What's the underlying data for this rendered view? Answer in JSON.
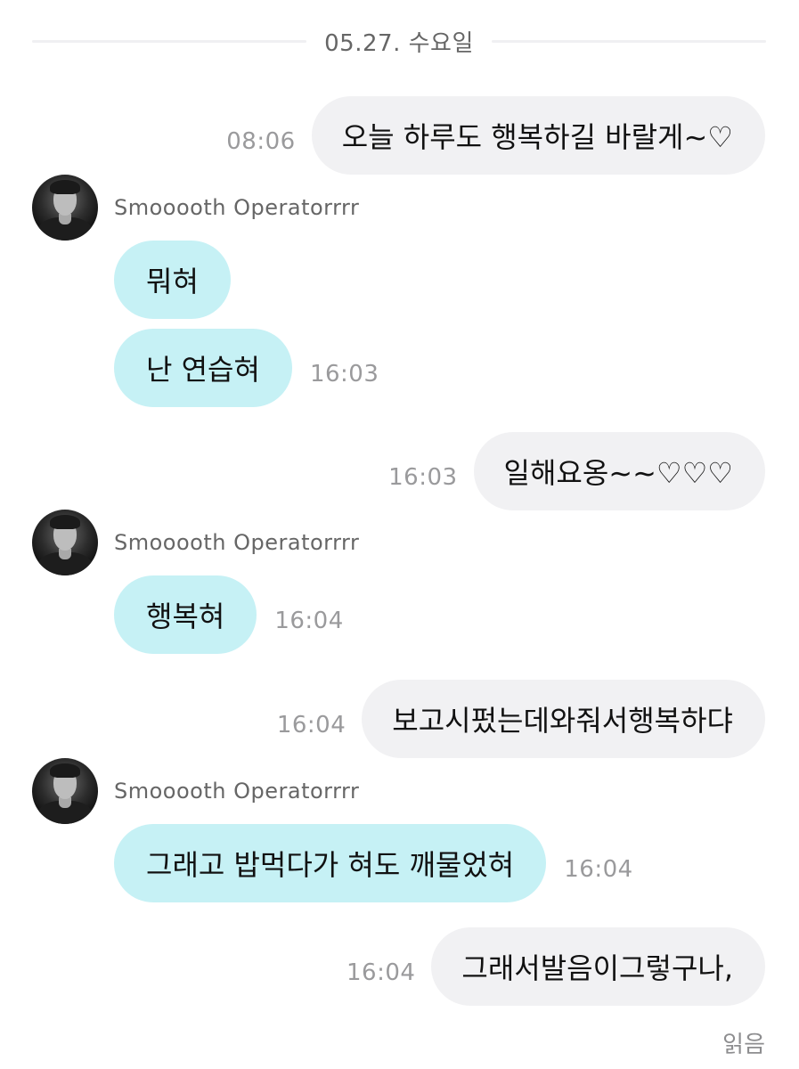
{
  "date_divider": "05.27. 수요일",
  "sender_name": "Smooooth Operatorrrr",
  "messages": {
    "m1": {
      "text": "오늘 하루도 행복하길 바랄게~♡",
      "time": "08:06"
    },
    "g1": {
      "b1": "뭐혀",
      "b2": "난 연습혀",
      "time": "16:03"
    },
    "m2": {
      "text": "일해요옹~~♡♡♡",
      "time": "16:03"
    },
    "g2": {
      "b1": "행복혀",
      "time": "16:04"
    },
    "m3": {
      "text": "보고시펐는데와줘서행복하댜",
      "time": "16:04"
    },
    "g3": {
      "b1": "그래고 밥먹다가 혀도 깨물었혀",
      "time": "16:04"
    },
    "m4": {
      "text": "그래서발음이그렇구나,",
      "time": "16:04"
    }
  },
  "read_label": "읽음",
  "colors": {
    "sent_bubble": "#f1f1f3",
    "received_bubble": "#c6f1f5"
  }
}
